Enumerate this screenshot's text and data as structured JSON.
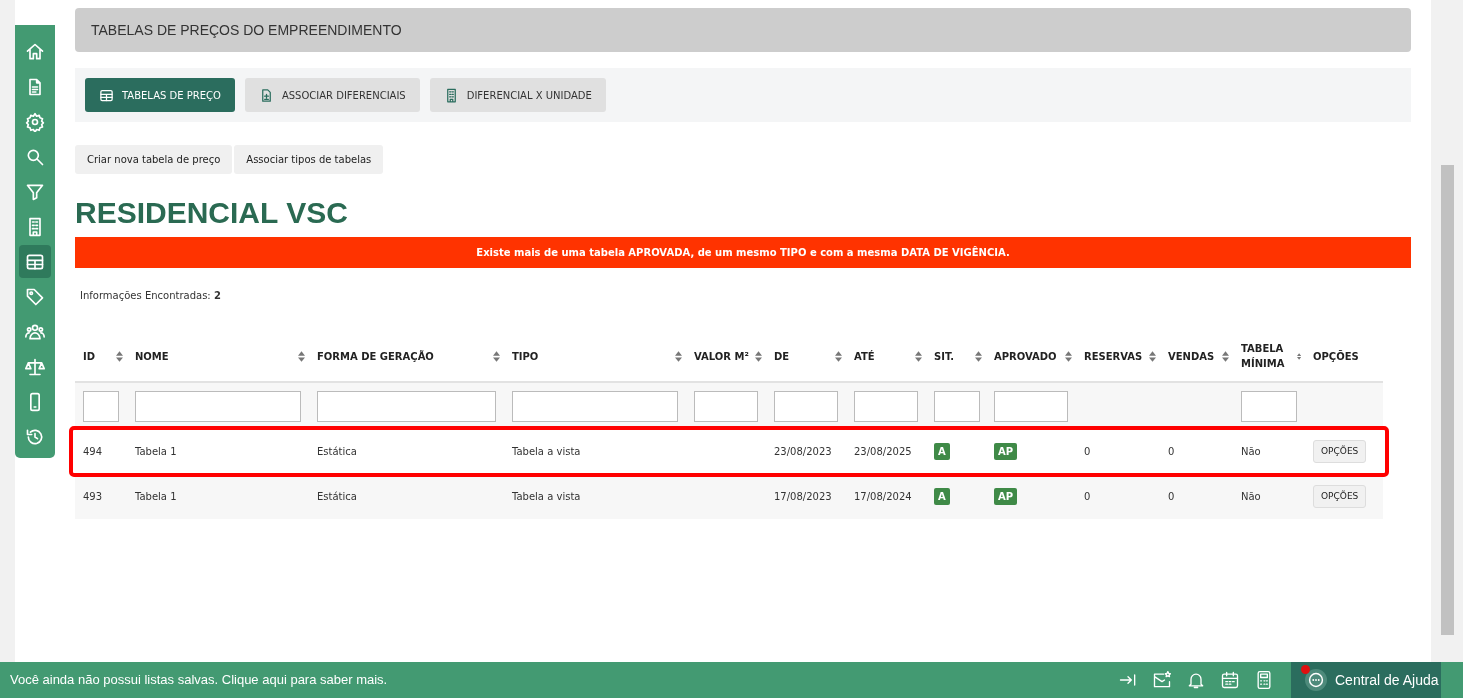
{
  "sidebar": {
    "items": [
      {
        "selected": false
      },
      {
        "selected": false
      },
      {
        "selected": false
      },
      {
        "selected": false
      },
      {
        "selected": false
      },
      {
        "selected": false
      },
      {
        "selected": true
      },
      {
        "selected": false
      },
      {
        "selected": false
      },
      {
        "selected": false
      },
      {
        "selected": false
      },
      {
        "selected": false
      }
    ]
  },
  "page_title": "TABELAS DE PREÇOS DO EMPREENDIMENTO",
  "tabs": [
    {
      "label": "TABELAS DE PREÇO",
      "selected": true
    },
    {
      "label": "ASSOCIAR DIFERENCIAIS",
      "selected": false
    },
    {
      "label": "DIFERENCIAL X UNIDADE",
      "selected": false
    }
  ],
  "actions": [
    "Criar nova tabela de preço",
    "Associar tipos de tabelas"
  ],
  "heading": "RESIDENCIAL VSC",
  "alert": "Existe mais de uma tabela APROVADA, de um mesmo TIPO e com a mesma DATA DE VIGÊNCIA.",
  "results": "Informações Encontradas: **2**",
  "table": {
    "columns": [
      {
        "label": "ID",
        "sortable": true,
        "kind": "text"
      },
      {
        "label": "NOME",
        "sortable": true,
        "kind": "text"
      },
      {
        "label": "FORMA DE GERAÇÃO",
        "sortable": true,
        "kind": "select"
      },
      {
        "label": "TIPO",
        "sortable": true,
        "kind": "text"
      },
      {
        "label": "VALOR M²",
        "sortable": true,
        "kind": "text"
      },
      {
        "label": "DE",
        "sortable": true,
        "kind": "text"
      },
      {
        "label": "ATÉ",
        "sortable": true,
        "kind": "text"
      },
      {
        "label": "SIT.",
        "sortable": true,
        "kind": "select"
      },
      {
        "label": "APROVADO",
        "sortable": true,
        "kind": "select"
      },
      {
        "label": "RESERVAS",
        "sortable": true,
        "kind": "plain"
      },
      {
        "label": "VENDAS",
        "sortable": true,
        "kind": "plain"
      },
      {
        "label": "TABELA MÍNIMA",
        "sortable": true,
        "kind": "select"
      },
      {
        "label": "OPÇÕES",
        "sortable": false,
        "kind": "plain"
      }
    ],
    "rows": [
      {
        "highlighted": true,
        "cells": [
          "494",
          "Tabela 1",
          "Estática",
          "Tabela a vista",
          "",
          "23/08/2023",
          "23/08/2025",
          "A",
          "AP",
          "0",
          "0",
          "Não",
          "OPÇÕES"
        ]
      },
      {
        "highlighted": false,
        "cells": [
          "493",
          "Tabela 1",
          "Estática",
          "Tabela a vista",
          "",
          "17/08/2023",
          "17/08/2024",
          "A",
          "AP",
          "0",
          "0",
          "Não",
          "OPÇÕES"
        ]
      }
    ]
  },
  "footer": {
    "message": "Você ainda não possui listas salvas. Clique aqui para saber mais.",
    "help": {
      "label": "Central de Ajuda",
      "notification": true
    }
  }
}
